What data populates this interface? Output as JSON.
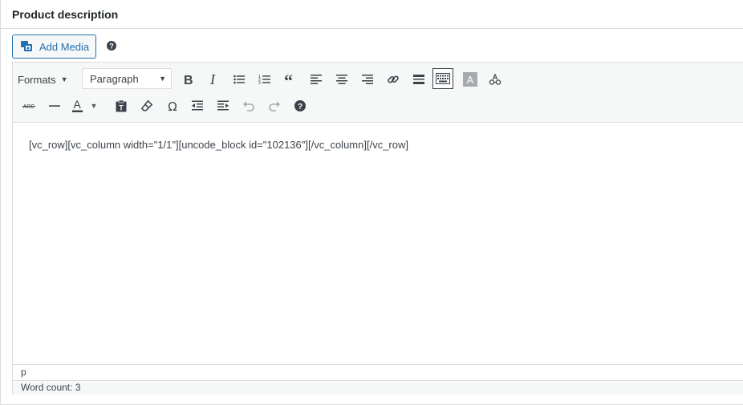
{
  "box": {
    "title": "Product description"
  },
  "media": {
    "add_media_label": "Add Media"
  },
  "toolbar": {
    "formats_label": "Formats",
    "block_select": "Paragraph",
    "row1_icons": [
      "bold-icon",
      "italic-icon",
      "bullet-list-icon",
      "numbered-list-icon",
      "blockquote-icon",
      "align-left-icon",
      "align-center-icon",
      "align-right-icon",
      "link-icon",
      "read-more-icon",
      "toolbar-toggle-icon",
      "text-highlight-icon",
      "spellcheck-icon"
    ],
    "row2_icons": [
      "strikethrough-icon",
      "horizontal-line-icon",
      "text-color-icon",
      "paste-text-icon",
      "clear-formatting-icon",
      "special-character-icon",
      "outdent-icon",
      "indent-icon",
      "undo-icon",
      "redo-icon",
      "help-icon"
    ]
  },
  "editor": {
    "content": "[vc_row][vc_column width=\"1/1\"][uncode_block id=\"102136\"][/vc_column][/vc_row]",
    "path": "p",
    "word_count": "Word count: 3"
  }
}
